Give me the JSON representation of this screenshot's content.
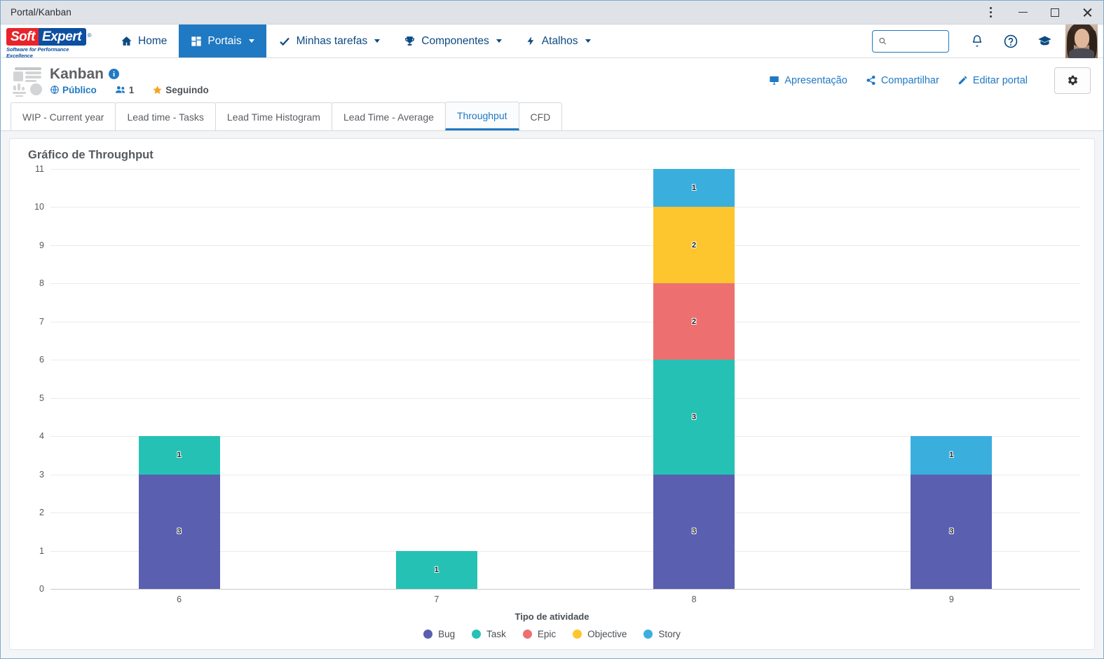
{
  "window": {
    "title": "Portal/Kanban",
    "controls": {
      "menu": "⋮",
      "minimize": "–",
      "maximize": "□",
      "close": "✕"
    }
  },
  "brand": {
    "name_part1": "Soft",
    "name_part2": "Expert",
    "registered": "®",
    "tagline": "Software for Performance Excellence"
  },
  "nav": {
    "items": [
      {
        "label": "Home",
        "icon": "home-icon",
        "has_caret": false,
        "active": false
      },
      {
        "label": "Portais",
        "icon": "grid-icon",
        "has_caret": true,
        "active": true
      },
      {
        "label": "Minhas tarefas",
        "icon": "check-icon",
        "has_caret": true,
        "active": false
      },
      {
        "label": "Componentes",
        "icon": "trophy-icon",
        "has_caret": true,
        "active": false
      },
      {
        "label": "Atalhos",
        "icon": "bolt-icon",
        "has_caret": true,
        "active": false
      }
    ],
    "search": {
      "value": "",
      "placeholder": ""
    },
    "icons": [
      {
        "name": "notifications-bell-icon"
      },
      {
        "name": "help-question-icon"
      },
      {
        "name": "academy-graduation-cap-icon"
      }
    ]
  },
  "portal": {
    "title": "Kanban",
    "info_glyph": "i",
    "visibility": "Público",
    "members_count": "1",
    "following": "Seguindo",
    "actions": [
      {
        "label": "Apresentação",
        "icon": "presentation-icon"
      },
      {
        "label": "Compartilhar",
        "icon": "share-icon"
      },
      {
        "label": "Editar portal",
        "icon": "pencil-icon"
      }
    ],
    "settings_icon": "gear-icon"
  },
  "tabs": [
    {
      "label": "WIP - Current year",
      "active": false
    },
    {
      "label": "Lead time - Tasks",
      "active": false
    },
    {
      "label": "Lead Time Histogram",
      "active": false
    },
    {
      "label": "Lead Time - Average",
      "active": false
    },
    {
      "label": "Throughput",
      "active": true
    },
    {
      "label": "CFD",
      "active": false
    }
  ],
  "panel": {
    "title": "Gráfico de Throughput"
  },
  "chart_data": {
    "type": "bar",
    "stacked": true,
    "title": "Gráfico de Throughput",
    "xlabel": "Tipo de atividade",
    "ylabel": "",
    "categories": [
      "6",
      "7",
      "8",
      "9"
    ],
    "ylim": [
      0,
      11
    ],
    "yticks": [
      "0",
      "1",
      "2",
      "3",
      "4",
      "5",
      "6",
      "7",
      "8",
      "9",
      "10",
      "11"
    ],
    "grid": true,
    "legend_position": "bottom",
    "legend_title": "Tipo de atividade",
    "series": [
      {
        "name": "Bug",
        "color": "#5b5fb0",
        "values": [
          3,
          0,
          3,
          3
        ]
      },
      {
        "name": "Task",
        "color": "#26c1b5",
        "values": [
          1,
          1,
          3,
          0
        ]
      },
      {
        "name": "Epic",
        "color": "#ee6f6f",
        "values": [
          0,
          0,
          2,
          0
        ]
      },
      {
        "name": "Objective",
        "color": "#fdc62e",
        "values": [
          0,
          0,
          2,
          0
        ]
      },
      {
        "name": "Story",
        "color": "#3aafde",
        "values": [
          0,
          0,
          1,
          1
        ]
      }
    ],
    "totals": [
      4,
      1,
      11,
      4
    ]
  }
}
